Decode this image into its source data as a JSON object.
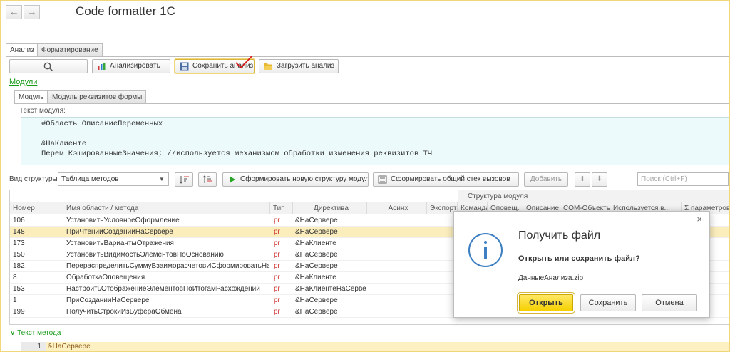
{
  "header": {
    "title": "Code formatter 1C",
    "back": "←",
    "forward": "→"
  },
  "tabs": [
    {
      "label": "Анализ"
    },
    {
      "label": "Форматирование"
    }
  ],
  "toolbar": {
    "analyze_label": "Анализировать",
    "save_label": "Сохранить анализ",
    "load_label": "Загрузить анализ"
  },
  "modules_link": "Модули",
  "subtabs": [
    {
      "label": "Модуль"
    },
    {
      "label": "Модуль реквизитов формы"
    }
  ],
  "module_text_label": "Текст модуля:",
  "code_lines": [
    "#Область ОписаниеПеременных",
    "",
    "&НаКлиенте",
    "Перем КэшированныеЗначения; //используется механизмом обработки изменения реквизитов ТЧ"
  ],
  "structure": {
    "label": "Вид структуры:",
    "selected": "Таблица методов",
    "form_new_label": "Сформировать новую структуру модуля",
    "form_stack_label": "Сформировать общий стек вызовов",
    "add_label": "Добавить",
    "search_placeholder": "Поиск (Ctrl+F)"
  },
  "table": {
    "group_header": "Структура модуля",
    "columns": [
      "Номер",
      "Имя области / метода",
      "Тип",
      "Директива",
      "Асинх",
      "Экспорт",
      "Команда",
      "Оповещ.",
      "Описание",
      "COM-Объекты",
      "Используется в...",
      "Σ параметров"
    ],
    "rows": [
      {
        "num": "106",
        "name": "УстановитьУсловноеОформление",
        "type": "pr",
        "directive": "&НаСервере"
      },
      {
        "num": "148",
        "name": "ПриЧтенииСозданииНаСервере",
        "type": "pr",
        "directive": "&НаСервере",
        "selected": true
      },
      {
        "num": "173",
        "name": "УстановитьВариантыОтражения",
        "type": "pr",
        "directive": "&НаКлиенте"
      },
      {
        "num": "150",
        "name": "УстановитьВидимостьЭлементовПоОснованию",
        "type": "pr",
        "directive": "&НаСервере"
      },
      {
        "num": "182",
        "name": "ПерераспределитьСуммуВзаиморасчетовИСформироватьНад...",
        "type": "pr",
        "directive": "&НаСервере"
      },
      {
        "num": "8",
        "name": "ОбработкаОповещения",
        "type": "pr",
        "directive": "&НаКлиенте"
      },
      {
        "num": "153",
        "name": "НастроитьОтображениеЭлементовПоИтогамРасхождений",
        "type": "pr",
        "directive": "&НаКлиентеНаСерве..."
      },
      {
        "num": "1",
        "name": "ПриСозданииНаСервере",
        "type": "pr",
        "directive": "&НаСервере"
      },
      {
        "num": "199",
        "name": "ПолучитьСтрокиИзБуфераОбмена",
        "type": "pr",
        "directive": "&НаСервере"
      }
    ]
  },
  "dialog": {
    "title": "Получить файл",
    "question": "Открыть или сохранить файл?",
    "filename": "ДанныеАнализа.zip",
    "open_label": "Открыть",
    "save_label": "Сохранить",
    "cancel_label": "Отмена",
    "close": "×"
  },
  "method_text": {
    "label": "Текст метода",
    "line_number": "1",
    "line": "&НаСервере"
  },
  "colors": {
    "accent_green": "#199a19",
    "highlight_yellow": "#fbedbc",
    "primary_button": "#f5d000"
  }
}
